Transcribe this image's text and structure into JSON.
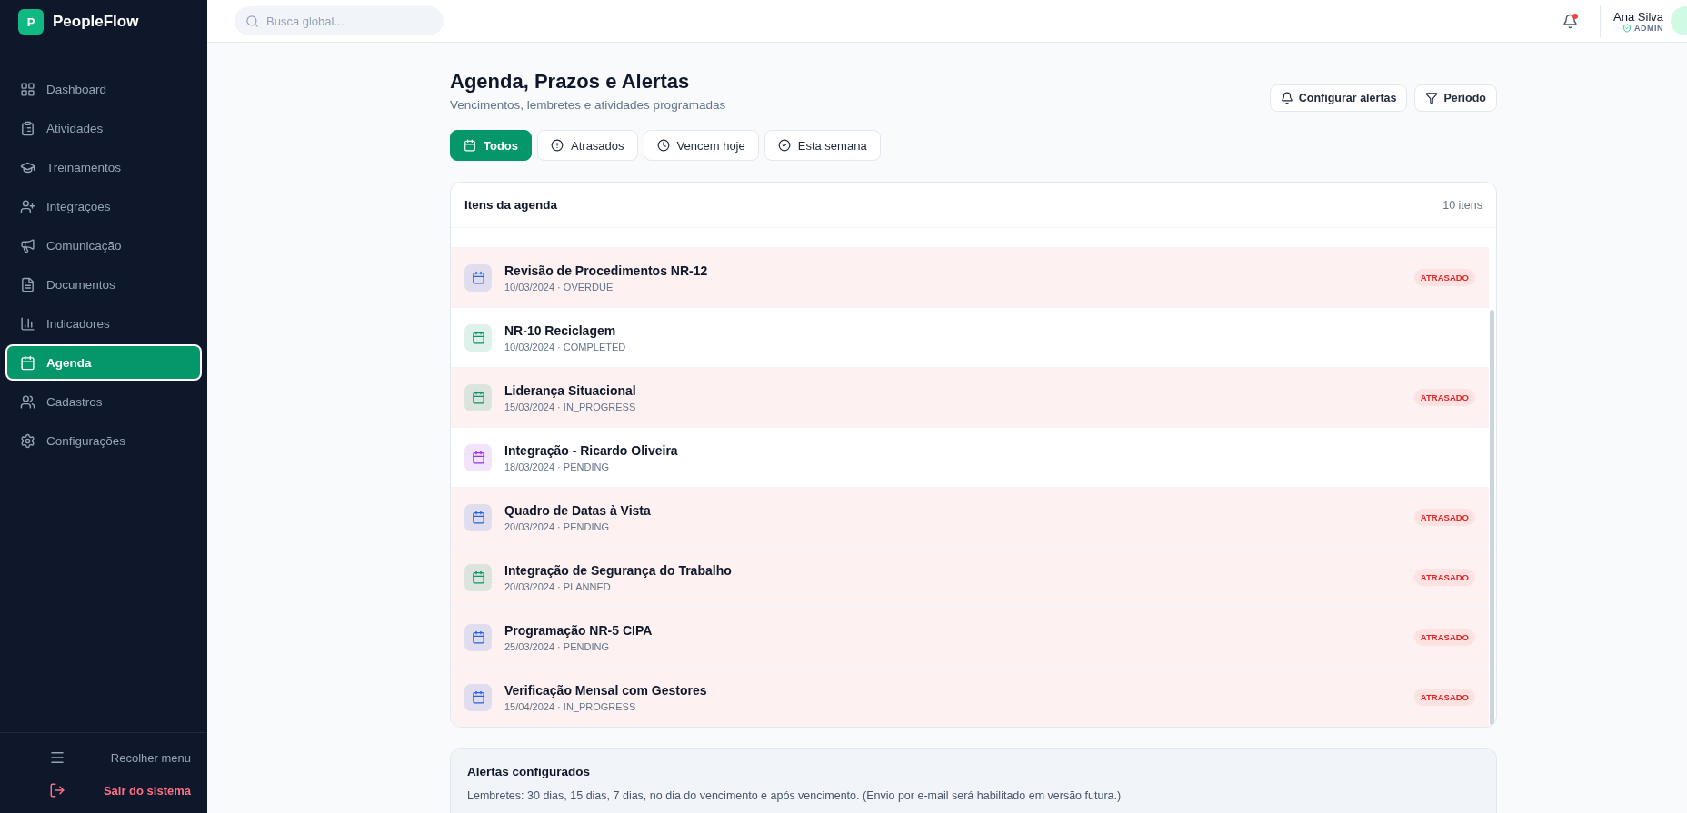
{
  "brand": {
    "letter": "P",
    "name": "PeopleFlow"
  },
  "sidebar": {
    "items": [
      {
        "label": "Dashboard",
        "selected": false
      },
      {
        "label": "Atividades",
        "selected": false
      },
      {
        "label": "Treinamentos",
        "selected": false
      },
      {
        "label": "Integrações",
        "selected": false
      },
      {
        "label": "Comunicação",
        "selected": false
      },
      {
        "label": "Documentos",
        "selected": false
      },
      {
        "label": "Indicadores",
        "selected": false
      },
      {
        "label": "Agenda",
        "selected": true
      },
      {
        "label": "Cadastros",
        "selected": false
      },
      {
        "label": "Configurações",
        "selected": false
      }
    ],
    "collapse": "Recolher menu",
    "logout": "Sair do sistema"
  },
  "topbar": {
    "search": {
      "placeholder": "Busca global..."
    },
    "notification": true,
    "user": {
      "name": "Ana Silva",
      "role": "ADMIN"
    }
  },
  "page": {
    "title": "Agenda, Prazos e Alertas",
    "subtitle": "Vencimentos, lembretes e atividades programadas",
    "actions": [
      {
        "label": "Configurar alertas"
      },
      {
        "label": "Período"
      }
    ],
    "tabs": [
      {
        "label": "Todos",
        "selected": true
      },
      {
        "label": "Atrasados",
        "selected": false
      },
      {
        "label": "Vencem hoje",
        "selected": false
      },
      {
        "label": "Esta semana",
        "selected": false
      }
    ]
  },
  "agenda": {
    "title": "Itens da agenda",
    "count": "10 itens",
    "items": [
      {
        "title": "Revisão de Procedimentos NR-12",
        "meta": "10/03/2024 · OVERDUE",
        "color": "#2563eb",
        "overdue": true,
        "badge": "ATRASADO"
      },
      {
        "title": "NR-10 Reciclagem",
        "meta": "10/03/2024 · COMPLETED",
        "color": "#059669",
        "overdue": false
      },
      {
        "title": "Liderança Situacional",
        "meta": "15/03/2024 · IN_PROGRESS",
        "color": "#059669",
        "overdue": true,
        "badge": "ATRASADO"
      },
      {
        "title": "Integração - Ricardo Oliveira",
        "meta": "18/03/2024 · PENDING",
        "color": "#9333ea",
        "overdue": false
      },
      {
        "title": "Quadro de Datas à Vista",
        "meta": "20/03/2024 · PENDING",
        "color": "#2563eb",
        "overdue": true,
        "badge": "ATRASADO"
      },
      {
        "title": "Integração de Segurança do Trabalho",
        "meta": "20/03/2024 · PLANNED",
        "color": "#059669",
        "overdue": true,
        "badge": "ATRASADO"
      },
      {
        "title": "Programação NR-5 CIPA",
        "meta": "25/03/2024 · PENDING",
        "color": "#2563eb",
        "overdue": true,
        "badge": "ATRASADO"
      },
      {
        "title": "Verificação Mensal com Gestores",
        "meta": "15/04/2024 · IN_PROGRESS",
        "color": "#2563eb",
        "overdue": true,
        "badge": "ATRASADO"
      }
    ]
  },
  "alerts": {
    "title": "Alertas configurados",
    "text": "Lembretes: 30 dias, 15 dias, 7 dias, no dia do vencimento e após vencimento. (Envio por e-mail será habilitado em versão futura.)"
  }
}
